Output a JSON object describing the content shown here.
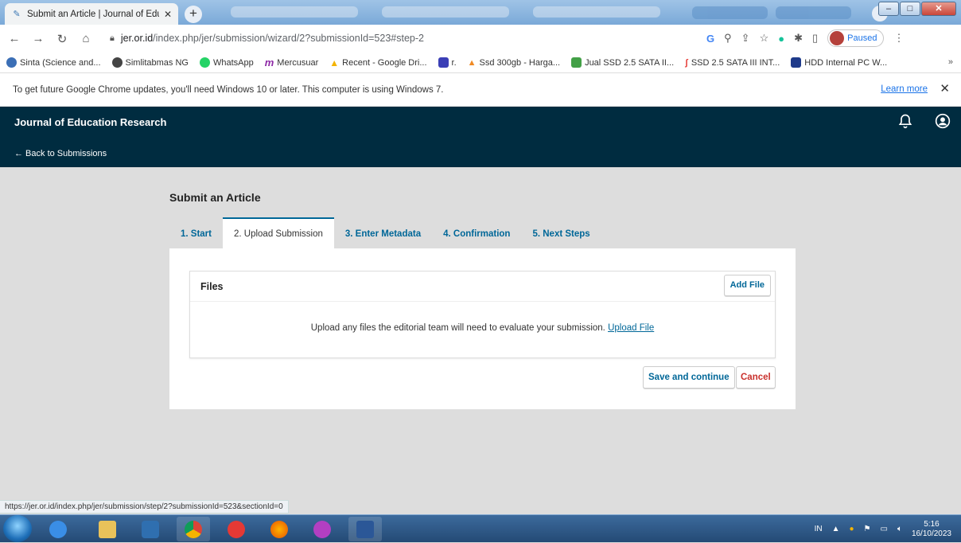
{
  "browser": {
    "tab_title": "Submit an Article | Journal of Edu",
    "url_host": "jer.or.id",
    "url_path": "/index.php/jer/submission/wizard/2?submissionId=523#step-2",
    "profile_status": "Paused"
  },
  "bookmarks": [
    {
      "label": "Sinta (Science and...",
      "color": "#3b6fb6"
    },
    {
      "label": "Simlitabmas NG",
      "color": "#444444"
    },
    {
      "label": "WhatsApp",
      "color": "#25d366"
    },
    {
      "label": "Mercusuar",
      "color": "#8e2aa6"
    },
    {
      "label": "Recent - Google Dri...",
      "color": "#f4b400"
    },
    {
      "label": "r.",
      "color": "#3b3fb6"
    },
    {
      "label": "Ssd 300gb - Harga...",
      "color": "#f08a24"
    },
    {
      "label": "Jual SSD 2.5 SATA II...",
      "color": "#43a047"
    },
    {
      "label": "SSD 2.5 SATA III INT...",
      "color": "#e53935"
    },
    {
      "label": "HDD Internal PC W...",
      "color": "#1e3a8a"
    }
  ],
  "infobar": {
    "message": "To get future Google Chrome updates, you'll need Windows 10 or later. This computer is using Windows 7.",
    "learn_more": "Learn more"
  },
  "app": {
    "journal_name": "Journal of Education Research",
    "back_link": "← Back to Submissions"
  },
  "page": {
    "title": "Submit an Article",
    "steps": [
      "1. Start",
      "2. Upload Submission",
      "3. Enter Metadata",
      "4. Confirmation",
      "5. Next Steps"
    ],
    "files_heading": "Files",
    "add_file": "Add File",
    "upload_message": "Upload any files the editorial team will need to evaluate your submission.",
    "upload_link": "Upload File",
    "save_button": "Save and continue",
    "cancel_button": "Cancel"
  },
  "status_url": "https://jer.or.id/index.php/jer/submission/step/2?submissionId=523&sectionId=0",
  "taskbar": {
    "language": "IN",
    "time": "5:16",
    "date": "16/10/2023"
  },
  "colors": {
    "header_bg": "#002c40",
    "link": "#006798",
    "cancel": "#c9302c"
  }
}
